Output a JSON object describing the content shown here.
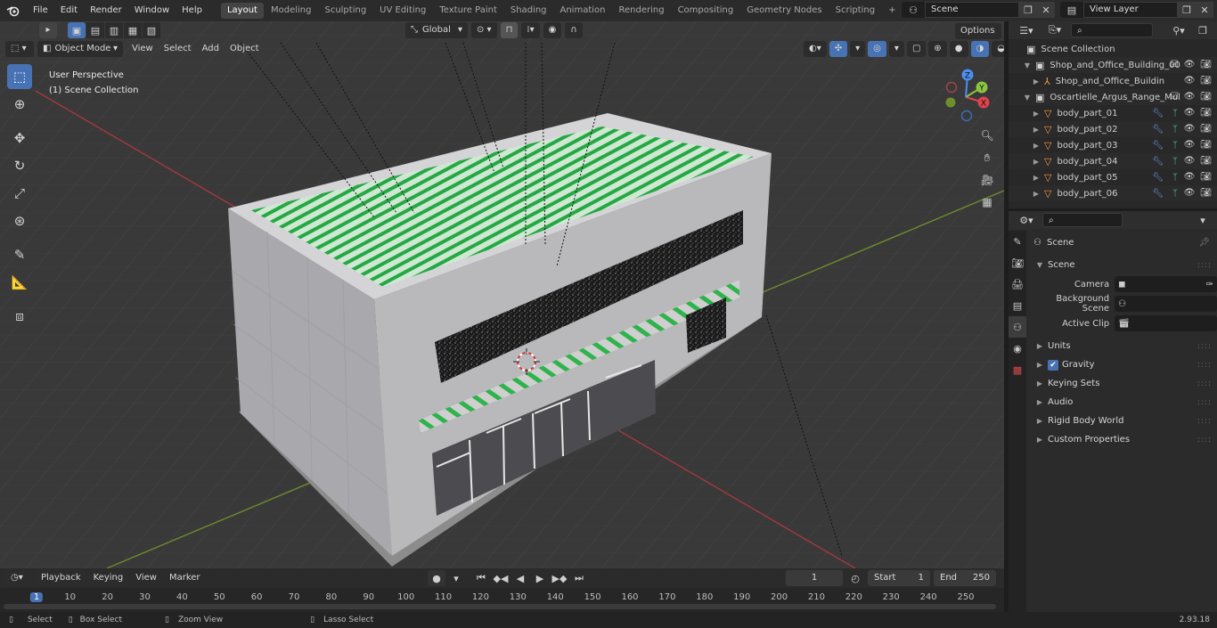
{
  "topbar": {
    "menus": [
      "File",
      "Edit",
      "Render",
      "Window",
      "Help"
    ],
    "workspaces": [
      "Layout",
      "Modeling",
      "Sculpting",
      "UV Editing",
      "Texture Paint",
      "Shading",
      "Animation",
      "Rendering",
      "Compositing",
      "Geometry Nodes",
      "Scripting"
    ],
    "active_workspace": "Layout",
    "add_tab": "+",
    "scene_name": "Scene",
    "view_layer": "View Layer"
  },
  "viewport": {
    "mode": "Object Mode",
    "menus": [
      "View",
      "Select",
      "Add",
      "Object"
    ],
    "orientation": "Global",
    "options_label": "Options",
    "overlay_title": "User Perspective",
    "overlay_collection": "(1) Scene Collection",
    "gizmo": {
      "x": "X",
      "y": "Y",
      "z": "Z"
    }
  },
  "outliner": {
    "rows": [
      {
        "label": "Scene Collection",
        "level": 0,
        "icon": "collection-icon",
        "vis": false
      },
      {
        "label": "Shop_and_Office_Building_00",
        "level": 1,
        "icon": "collection-icon",
        "vis": true
      },
      {
        "label": "Shop_and_Office_Buildin",
        "level": 2,
        "icon": "empty-icon",
        "vis": true
      },
      {
        "label": "Oscartielle_Argus_Range_Mul",
        "level": 1,
        "icon": "collection-icon",
        "vis": true
      },
      {
        "label": "body_part_01",
        "level": 2,
        "icon": "mesh-icon",
        "vis": true
      },
      {
        "label": "body_part_02",
        "level": 2,
        "icon": "mesh-icon",
        "vis": true
      },
      {
        "label": "body_part_03",
        "level": 2,
        "icon": "mesh-icon",
        "vis": true
      },
      {
        "label": "body_part_04",
        "level": 2,
        "icon": "mesh-icon",
        "vis": true
      },
      {
        "label": "body_part_05",
        "level": 2,
        "icon": "mesh-icon",
        "vis": true
      },
      {
        "label": "body_part_06",
        "level": 2,
        "icon": "mesh-icon",
        "vis": true
      }
    ]
  },
  "properties": {
    "context_title": "Scene",
    "scene_panel": "Scene",
    "camera_label": "Camera",
    "background_scene_label": "Background Scene",
    "active_clip_label": "Active Clip",
    "panels": [
      "Units",
      "Gravity",
      "Keying Sets",
      "Audio",
      "Rigid Body World",
      "Custom Properties"
    ],
    "gravity_checked": true
  },
  "timeline": {
    "menus": [
      "Playback",
      "Keying",
      "View",
      "Marker"
    ],
    "current_frame": "1",
    "start_label": "Start",
    "start_value": "1",
    "end_label": "End",
    "end_value": "250",
    "ruler": [
      "1",
      "10",
      "20",
      "30",
      "40",
      "50",
      "60",
      "70",
      "80",
      "90",
      "100",
      "110",
      "120",
      "130",
      "140",
      "150",
      "160",
      "170",
      "180",
      "190",
      "200",
      "210",
      "220",
      "230",
      "240",
      "250"
    ]
  },
  "statusbar": {
    "select": "Select",
    "box_select": "Box Select",
    "zoom_view": "Zoom View",
    "lasso_select": "Lasso Select",
    "version": "2.93.18"
  },
  "colors": {
    "accent": "#4772b3",
    "axis_x": "#e0424e",
    "axis_y": "#8bc540",
    "axis_z": "#4d8ef0",
    "roof_green": "#2bb14a"
  }
}
